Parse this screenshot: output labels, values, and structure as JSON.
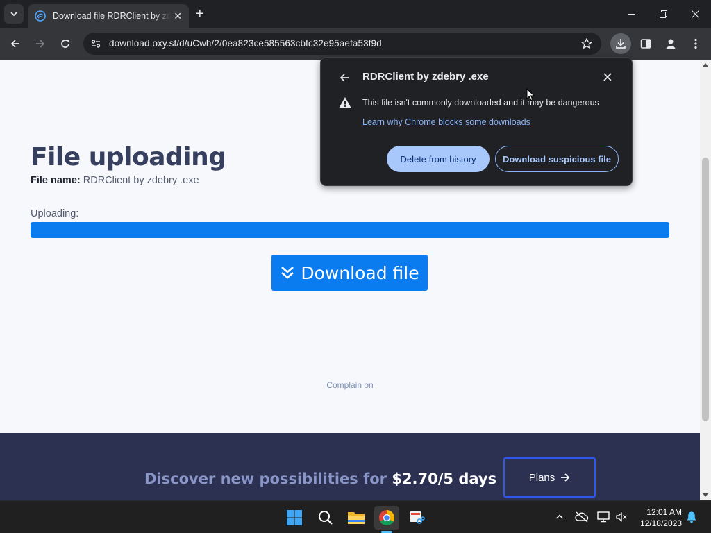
{
  "browser": {
    "tab_title": "Download file RDRClient by zdebry .exe",
    "url": "download.oxy.st/d/uCwh/2/0ea823ce585563cbfc32e95aefa53f9d",
    "new_tab_label": "+"
  },
  "page": {
    "title": "File uploading",
    "file_name_label": "File name:",
    "file_name_value": "RDRClient by zdebry .exe",
    "uploading_label": "Uploading:",
    "upload_progress_percent": 100,
    "download_button_label": "Download file",
    "complain_text": "Complain on",
    "promo_text": "Discover new possibilities for",
    "promo_price": "$2.70/5 days",
    "plans_button_label": "Plans"
  },
  "download_bubble": {
    "title": "RDRClient by zdebry .exe",
    "warning_message": "This file isn't commonly downloaded and it may be dangerous",
    "learn_more_link": "Learn why Chrome blocks some downloads",
    "delete_button": "Delete from history",
    "keep_button": "Download suspicious file"
  },
  "taskbar": {
    "time": "12:01 AM",
    "date": "12/18/2023",
    "pinned_apps": [
      "start-icon",
      "search-icon",
      "file-explorer-icon",
      "chrome-icon",
      "snipping-tool-icon"
    ]
  },
  "colors": {
    "accent": "#0a7cf0",
    "heading": "#373f5f",
    "footer_band": "#2c3152",
    "bubble_bg": "#202124",
    "link": "#8ab4f8"
  }
}
